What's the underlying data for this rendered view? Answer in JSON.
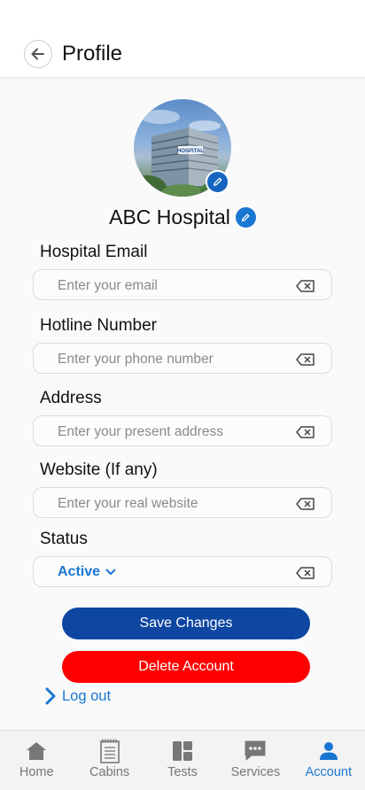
{
  "header": {
    "title": "Profile"
  },
  "profile": {
    "name": "ABC Hospital",
    "building_sign": "HOSPITAL"
  },
  "fields": [
    {
      "label": "Hospital Email",
      "placeholder": "Enter your email"
    },
    {
      "label": "Hotline Number",
      "placeholder": "Enter your phone number"
    },
    {
      "label": "Address",
      "placeholder": "Enter your present address"
    },
    {
      "label": "Website (If any)",
      "placeholder": "Enter your real website"
    }
  ],
  "status": {
    "label": "Status",
    "value": "Active"
  },
  "actions": {
    "save_label": "Save Changes",
    "delete_label": "Delete Account",
    "logout_label": "Log out"
  },
  "nav": {
    "items": [
      {
        "label": "Home",
        "icon": "home-icon"
      },
      {
        "label": "Cabins",
        "icon": "cabins-icon"
      },
      {
        "label": "Tests",
        "icon": "tests-icon"
      },
      {
        "label": "Services",
        "icon": "services-icon"
      },
      {
        "label": "Account",
        "icon": "account-icon"
      }
    ],
    "active": "Account"
  },
  "colors": {
    "accent": "#1976d2",
    "save": "#0d47a1",
    "delete": "#ff0000",
    "nav_inactive": "#777777"
  }
}
